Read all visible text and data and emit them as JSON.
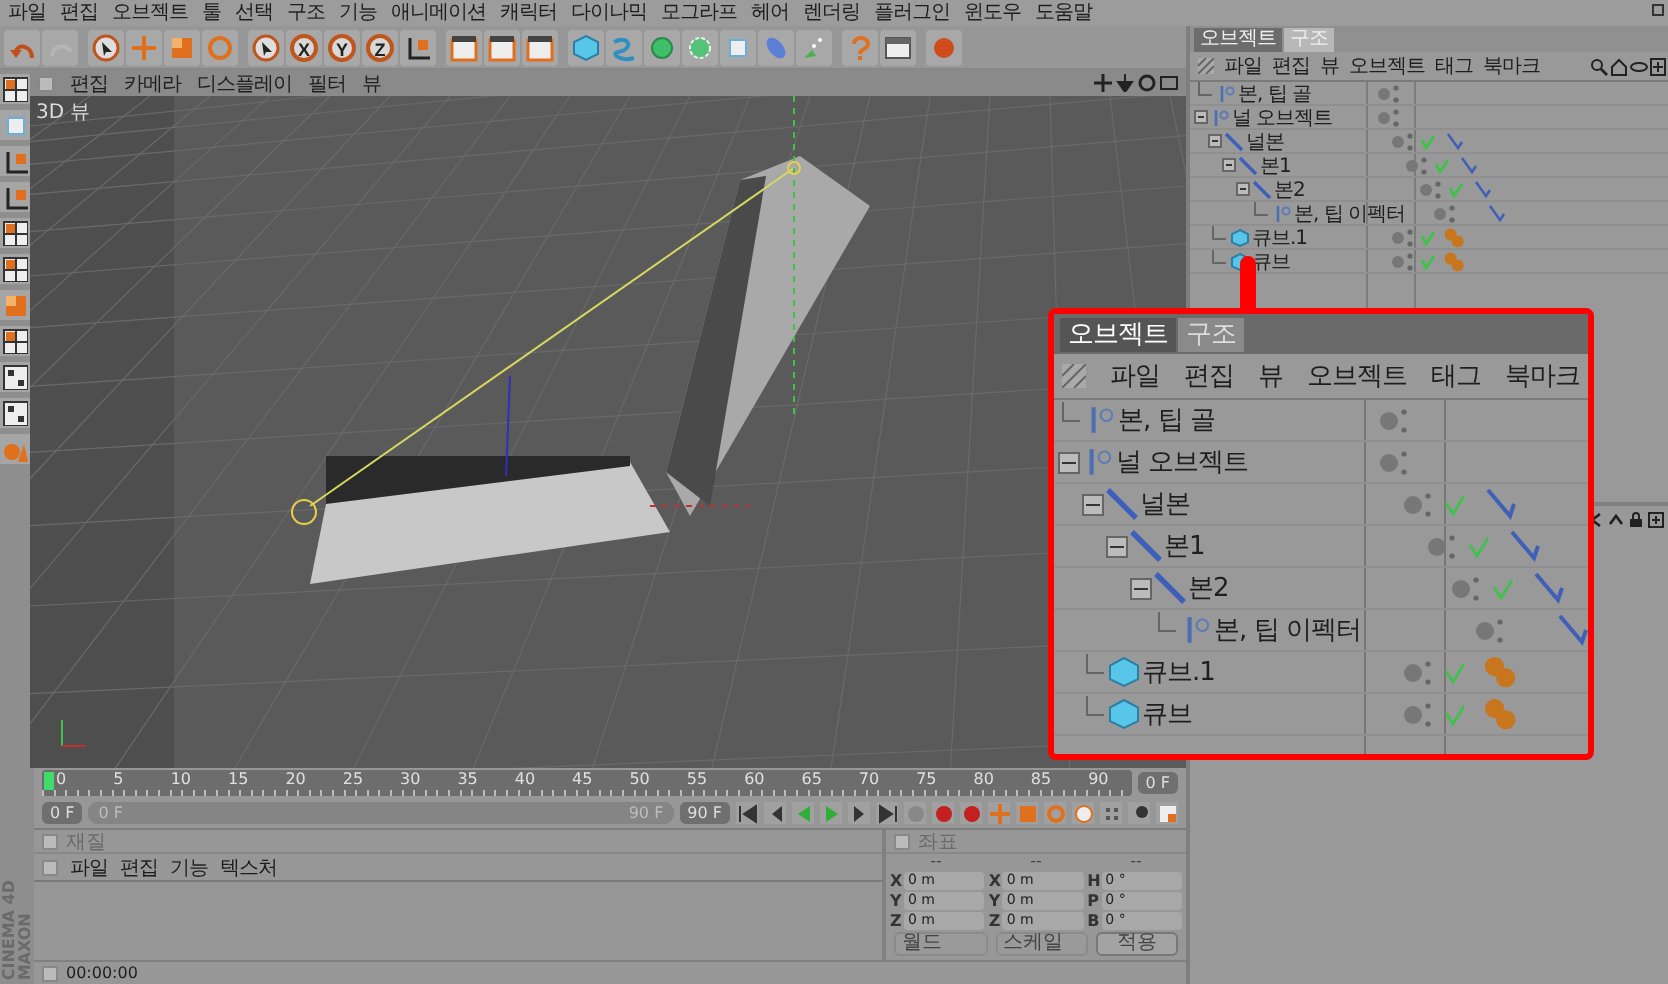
{
  "menubar": [
    "파일",
    "편집",
    "오브젝트",
    "툴",
    "선택",
    "구조",
    "기능",
    "애니메이션",
    "캐릭터",
    "다이나믹",
    "모그라프",
    "헤어",
    "렌더링",
    "플러그인",
    "윈도우",
    "도움말"
  ],
  "toolbar": {
    "axis_buttons": [
      "X",
      "Y",
      "Z"
    ]
  },
  "viewport": {
    "menu": [
      "편집",
      "카메라",
      "디스플레이",
      "필터",
      "뷰"
    ],
    "label": "3D 뷰"
  },
  "object_manager": {
    "tabs": [
      {
        "label": "오브젝트",
        "selected": true
      },
      {
        "label": "구조",
        "selected": false
      }
    ],
    "menu": [
      "파일",
      "편집",
      "뷰",
      "오브젝트",
      "태그",
      "북마크"
    ],
    "tree": [
      {
        "name": "본, 팁 골",
        "kind": "null",
        "enabled": false
      },
      {
        "name": "널 오브젝트",
        "kind": "null",
        "enabled": false,
        "expanded": true,
        "children": [
          {
            "name": "널본",
            "kind": "bone",
            "enabled": true,
            "tags": [
              {
                "kind": "bone"
              }
            ],
            "expanded": true,
            "children": [
              {
                "name": "본1",
                "kind": "bone",
                "enabled": true,
                "tags": [
                  {
                    "kind": "bone"
                  }
                ],
                "expanded": true,
                "children": [
                  {
                    "name": "본2",
                    "kind": "bone",
                    "enabled": true,
                    "tags": [
                      {
                        "kind": "bone"
                      }
                    ],
                    "expanded": true,
                    "children": [
                      {
                        "name": "본, 팁 이펙터",
                        "kind": "null",
                        "enabled": false,
                        "tags": [
                          {
                            "kind": "bone"
                          }
                        ]
                      }
                    ]
                  }
                ]
              }
            ]
          },
          {
            "name": "큐브.1",
            "kind": "cube",
            "enabled": true,
            "tags": [
              {
                "kind": "material"
              }
            ]
          },
          {
            "name": "큐브",
            "kind": "cube",
            "enabled": true,
            "tags": [
              {
                "kind": "material"
              }
            ]
          }
        ]
      }
    ]
  },
  "callout": {
    "tabs": [
      {
        "label": "오브젝트",
        "selected": true
      },
      {
        "label": "구조",
        "selected": false
      }
    ],
    "menu": [
      "파일",
      "편집",
      "뷰",
      "오브젝트",
      "태그",
      "북마크"
    ],
    "tree": [
      {
        "name": "본, 팁 골",
        "kind": "null",
        "enabled": false
      },
      {
        "name": "널 오브젝트",
        "kind": "null",
        "enabled": false,
        "expanded": true,
        "children": [
          {
            "name": "널본",
            "kind": "bone",
            "enabled": true,
            "tags": [
              {
                "kind": "bone"
              }
            ],
            "expanded": true,
            "children": [
              {
                "name": "본1",
                "kind": "bone",
                "enabled": true,
                "tags": [
                  {
                    "kind": "bone"
                  }
                ],
                "expanded": true,
                "children": [
                  {
                    "name": "본2",
                    "kind": "bone",
                    "enabled": true,
                    "tags": [
                      {
                        "kind": "bone"
                      }
                    ],
                    "expanded": true,
                    "children": [
                      {
                        "name": "본, 팁 이펙터",
                        "kind": "null",
                        "enabled": false,
                        "tags": [
                          {
                            "kind": "bone"
                          }
                        ]
                      }
                    ]
                  }
                ]
              }
            ]
          },
          {
            "name": "큐브.1",
            "kind": "cube",
            "enabled": true,
            "tags": [
              {
                "kind": "material"
              }
            ]
          },
          {
            "name": "큐브",
            "kind": "cube",
            "enabled": true,
            "tags": [
              {
                "kind": "material"
              }
            ]
          }
        ]
      }
    ]
  },
  "timeline": {
    "ruler": [
      "0",
      "5",
      "10",
      "15",
      "20",
      "25",
      "30",
      "35",
      "40",
      "45",
      "50",
      "55",
      "60",
      "65",
      "70",
      "75",
      "80",
      "85",
      "90"
    ],
    "current_field": "0 F",
    "start_field": "0 F",
    "range": {
      "start": "0 F",
      "end": "90 F",
      "level": 1
    },
    "end_field": "90 F"
  },
  "material": {
    "title": "재질",
    "menu": [
      "파일",
      "편집",
      "기능",
      "텍스처"
    ]
  },
  "coordinates": {
    "title": "좌표",
    "headers": [
      "--",
      "--",
      "--"
    ],
    "rows": [
      [
        {
          "label": "X",
          "value": "0 m"
        },
        {
          "label": "X",
          "value": "0 m"
        },
        {
          "label": "H",
          "value": "0 °"
        }
      ],
      [
        {
          "label": "Y",
          "value": "0 m"
        },
        {
          "label": "Y",
          "value": "0 m"
        },
        {
          "label": "P",
          "value": "0 °"
        }
      ],
      [
        {
          "label": "Z",
          "value": "0 m"
        },
        {
          "label": "Z",
          "value": "0 m"
        },
        {
          "label": "B",
          "value": "0 °"
        }
      ]
    ],
    "dropdowns": [
      "월드",
      "스케일"
    ],
    "apply": "적용"
  },
  "brand": [
    "MAXON",
    "CINEMA 4D"
  ],
  "status_bar": {
    "time": "00:00:00"
  }
}
